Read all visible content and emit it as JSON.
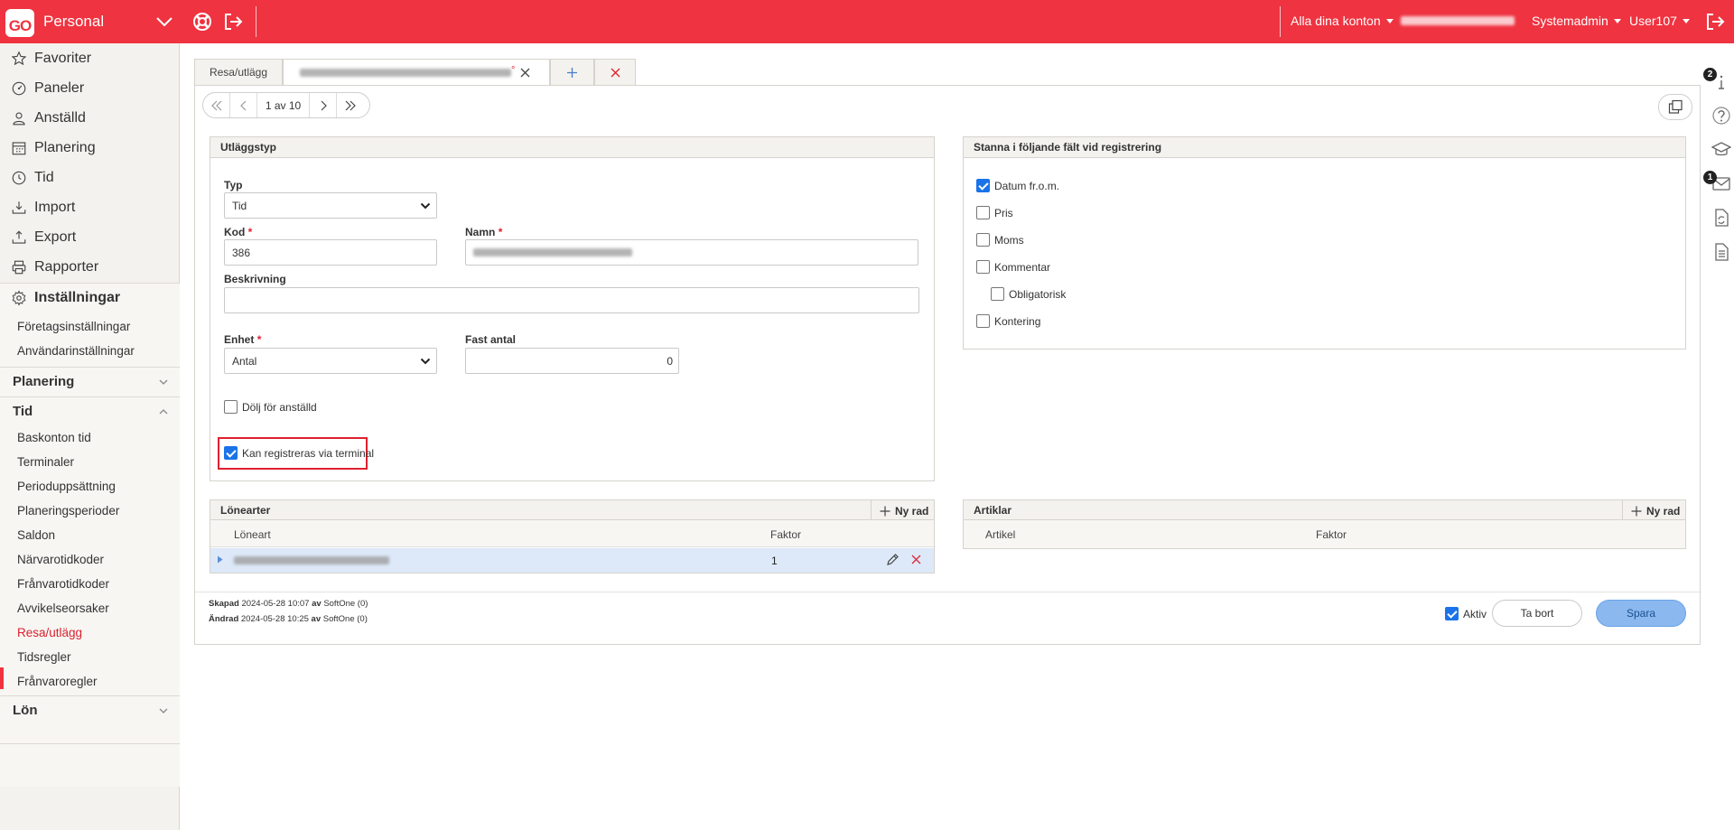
{
  "topbar": {
    "logo": "GO",
    "app_name": "Personal",
    "account_selector": "Alla dina konton",
    "role": "Systemadmin",
    "user": "User107",
    "colors": {
      "brand": "#ef3340"
    }
  },
  "sidebar": {
    "main_items": [
      {
        "label": "Favoriter",
        "icon": "star-icon"
      },
      {
        "label": "Paneler",
        "icon": "gauge-icon"
      },
      {
        "label": "Anställd",
        "icon": "person-icon"
      },
      {
        "label": "Planering",
        "icon": "calendar-icon"
      },
      {
        "label": "Tid",
        "icon": "clock-icon"
      },
      {
        "label": "Import",
        "icon": "import-icon"
      },
      {
        "label": "Export",
        "icon": "export-icon"
      },
      {
        "label": "Rapporter",
        "icon": "printer-icon"
      }
    ],
    "settings": {
      "title": "Inställningar",
      "items": [
        "Företagsinställningar",
        "Användarinställningar"
      ]
    },
    "groups": [
      {
        "title": "Planering",
        "expanded": false
      },
      {
        "title": "Tid",
        "expanded": true,
        "items": [
          "Baskonton tid",
          "Terminaler",
          "Perioduppsättning",
          "Planeringsperioder",
          "Saldon",
          "Närvarotidkoder",
          "Frånvarotidkoder",
          "Avvikelseorsaker",
          "Resa/utlägg",
          "Tidsregler",
          "Frånvaroregler"
        ],
        "active": "Resa/utlägg"
      },
      {
        "title": "Lön",
        "expanded": false
      }
    ]
  },
  "rail": {
    "badges": [
      "2",
      "1"
    ]
  },
  "tabs": {
    "first": "Resa/utlägg",
    "modified_marker": "°"
  },
  "pager": {
    "text": "1 av 10"
  },
  "utlaggstyp": {
    "title": "Utläggstyp",
    "typ_label": "Typ",
    "typ_value": "Tid",
    "kod_label": "Kod",
    "kod_value": "386",
    "namn_label": "Namn",
    "beskrivning_label": "Beskrivning",
    "enhet_label": "Enhet",
    "enhet_value": "Antal",
    "fast_antal_label": "Fast antal",
    "fast_antal_value": "0",
    "required_marker": "*",
    "dolj_label": "Dölj för anställd",
    "dolj_checked": false,
    "terminal_label": "Kan registreras via terminal",
    "terminal_checked": true
  },
  "stanna": {
    "title": "Stanna i följande fält vid registrering",
    "items": [
      {
        "label": "Datum fr.o.m.",
        "checked": true
      },
      {
        "label": "Pris",
        "checked": false
      },
      {
        "label": "Moms",
        "checked": false
      },
      {
        "label": "Kommentar",
        "checked": false
      },
      {
        "label": "Obligatorisk",
        "checked": false
      },
      {
        "label": "Kontering",
        "checked": false
      }
    ]
  },
  "lonearter": {
    "title": "Lönearter",
    "new_row": "Ny rad",
    "columns": [
      "Löneart",
      "Faktor"
    ],
    "rows": [
      {
        "faktor": "1"
      }
    ]
  },
  "artiklar": {
    "title": "Artiklar",
    "new_row": "Ny rad",
    "columns": [
      "Artikel",
      "Faktor"
    ]
  },
  "footer": {
    "created_label": "Skapad",
    "created_date": "2024-05-28 10:07",
    "created_by_label": "av",
    "created_by": "SoftOne (0)",
    "changed_label": "Ändrad",
    "changed_date": "2024-05-28 10:25",
    "changed_by_label": "av",
    "changed_by": "SoftOne (0)",
    "aktiv_label": "Aktiv",
    "aktiv_checked": true,
    "delete_label": "Ta bort",
    "save_label": "Spara"
  }
}
